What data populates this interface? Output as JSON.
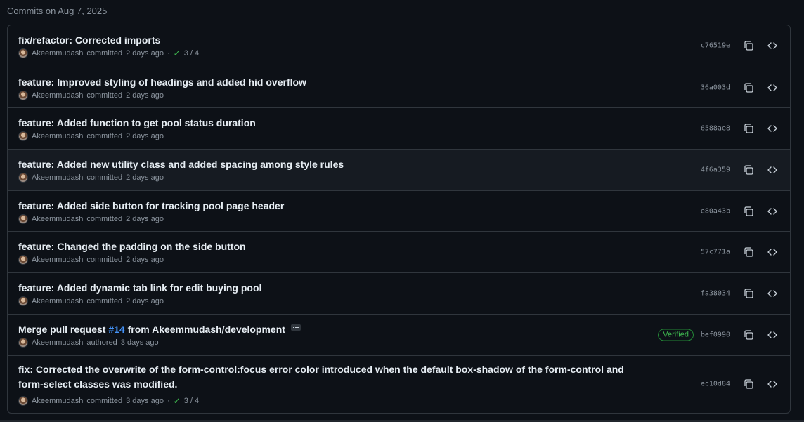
{
  "section_title": "Commits on Aug 7, 2025",
  "commits": [
    {
      "title": "fix/refactor: Corrected imports",
      "author": "Akeemmudash",
      "action": "committed",
      "time": "2 days ago",
      "separator": "·",
      "check_icon": "✓",
      "checks": "3 / 4",
      "sha": "c76519e"
    },
    {
      "title": "feature: Improved styling of headings and added hid overflow",
      "author": "Akeemmudash",
      "action": "committed",
      "time": "2 days ago",
      "sha": "36a003d"
    },
    {
      "title": "feature: Added function to get pool status duration",
      "author": "Akeemmudash",
      "action": "committed",
      "time": "2 days ago",
      "sha": "6588ae8"
    },
    {
      "title": "feature: Added new utility class and added spacing among style rules",
      "author": "Akeemmudash",
      "action": "committed",
      "time": "2 days ago",
      "sha": "4f6a359"
    },
    {
      "title": "feature: Added side button for tracking pool page header",
      "author": "Akeemmudash",
      "action": "committed",
      "time": "2 days ago",
      "sha": "e80a43b"
    },
    {
      "title": "feature: Changed the padding on the side button",
      "author": "Akeemmudash",
      "action": "committed",
      "time": "2 days ago",
      "sha": "57c771a"
    },
    {
      "title": "feature: Added dynamic tab link for edit buying pool",
      "author": "Akeemmudash",
      "action": "committed",
      "time": "2 days ago",
      "sha": "fa38034"
    },
    {
      "title_prefix": "Merge pull request ",
      "pr_link": "#14",
      "title_suffix": " from Akeemmudash/development",
      "author": "Akeemmudash",
      "action": "authored",
      "time": "3 days ago",
      "verified": "Verified",
      "sha": "bef0990"
    },
    {
      "title": "fix: Corrected the overwrite of the form-control:focus error color introduced when the default box-shadow of the form-control and form-select classes was modified.",
      "author": "Akeemmudash",
      "action": "committed",
      "time": "3 days ago",
      "separator": "·",
      "check_icon": "✓",
      "checks": "3 / 4",
      "sha": "ec10d84"
    }
  ],
  "colors": {
    "background": "#0d1117",
    "border": "#30363d",
    "hover_row": "#161b22",
    "muted_text": "#8b949e",
    "link": "#4493f8",
    "success": "#3fb950"
  }
}
